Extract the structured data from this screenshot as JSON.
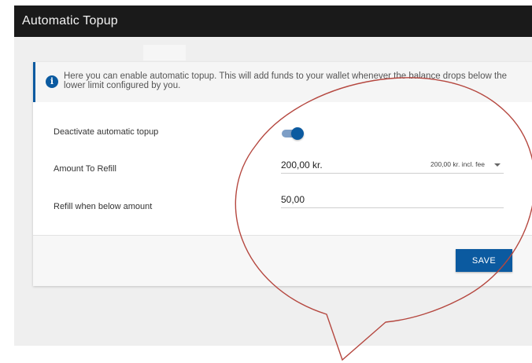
{
  "window": {
    "title": "Automatic Topup"
  },
  "info": {
    "text": "Here you can enable automatic topup. This will add funds to your wallet whenever the balance drops below the lower limit configured by you."
  },
  "form": {
    "toggle_label": "Deactivate automatic topup",
    "toggle_on": true,
    "amount_label": "Amount To Refill",
    "amount_value": "200,00 kr.",
    "amount_fee": "200,00 kr. incl. fee",
    "below_label": "Refill when below amount",
    "below_value": "50,00"
  },
  "actions": {
    "save_label": "SAVE"
  },
  "colors": {
    "accent": "#0b5aa0",
    "titlebar": "#1a1a1a",
    "callout_stroke": "#b5473f"
  }
}
